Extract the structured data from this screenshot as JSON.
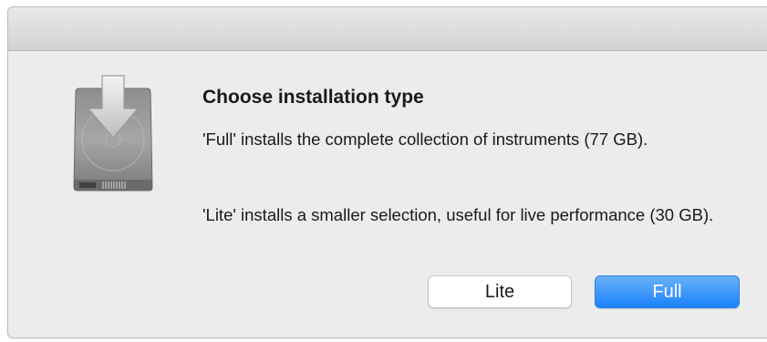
{
  "dialog": {
    "title": "Choose installation type",
    "paragraph_full": "'Full' installs the complete collection of instruments (77 GB).",
    "paragraph_lite": "'Lite' installs a smaller selection, useful for live performance (30 GB).",
    "icon": "install-drive-icon",
    "buttons": {
      "lite_label": "Lite",
      "full_label": "Full"
    },
    "colors": {
      "primary_button": "#2b8cfb",
      "dialog_background": "#ececec"
    }
  }
}
